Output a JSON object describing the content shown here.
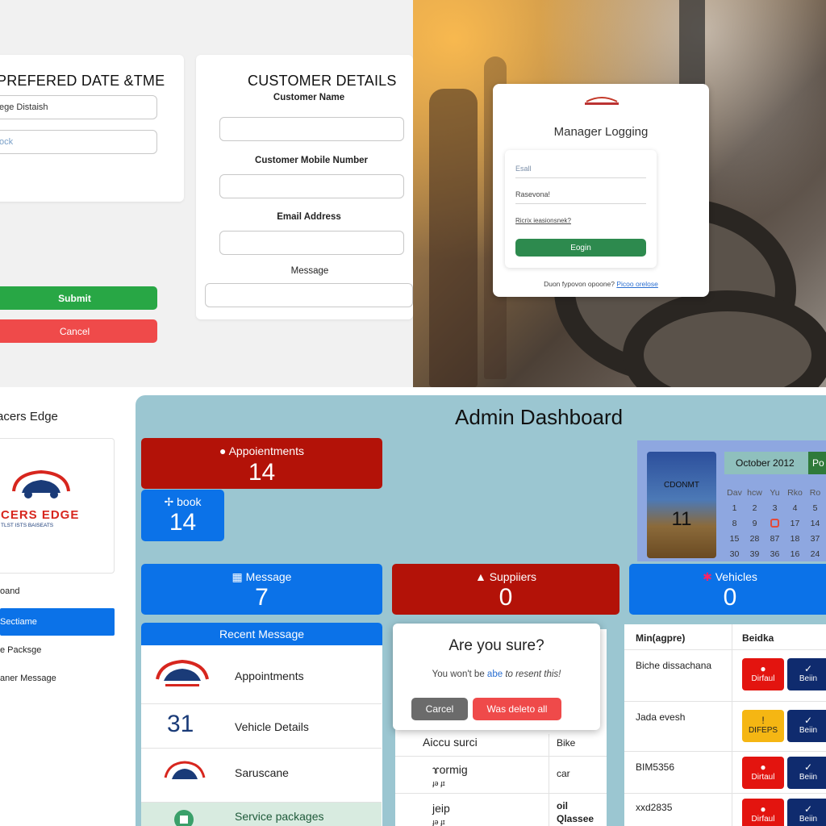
{
  "booking": {
    "date_title": "PREFERED DATE &TME",
    "date_value": "ege Distaish",
    "time_placeholder": "ock",
    "customer_title": "CUSTOMER DETAILS",
    "name_label": "Customer  Name",
    "mobile_label": "Customer Mobile Number",
    "email_label": "Email Address",
    "message_label": "Message",
    "submit_label": "Submit",
    "cancel_label": "Cancel"
  },
  "login": {
    "title": "Manager Logging",
    "email_placeholder": "Esall",
    "password_placeholder": "Rasevona!",
    "forgot": "Ricrix ieasionsnek?",
    "button": "Eogin",
    "signup_text": "Duon fypovon opoone?",
    "signup_link": "Picoo orelose"
  },
  "sidebar": {
    "brand": "acers Edge",
    "logo_name": "CERS EDGE",
    "logo_tag": "TLST ISTS BAISEATS",
    "items": [
      {
        "label": "oand"
      },
      {
        "label": "Sectiame"
      },
      {
        "label": "e Packsge"
      },
      {
        "label": "aner Message"
      }
    ]
  },
  "dashboard": {
    "title": "Admin Dashboard",
    "appointments": {
      "label": "Appoientments",
      "value": "14"
    },
    "book": {
      "label": "book",
      "value": "14"
    },
    "message": {
      "label": "Message",
      "value": "7"
    },
    "suppliers": {
      "label": "Suppiiers",
      "value": "0"
    },
    "vehicles": {
      "label": "Vehicles",
      "value": "0"
    },
    "calendar": {
      "month": "October 2012",
      "next": "Po",
      "image_text": "CDONMT",
      "image_num": "11",
      "headers": [
        "Dav",
        "hcw",
        "Yu",
        "Rko",
        "Ro"
      ],
      "rows": [
        [
          "1",
          "2",
          "3",
          "4",
          "5"
        ],
        [
          "8",
          "9",
          "",
          "17",
          "14"
        ],
        [
          "15",
          "28",
          "87",
          "18",
          "37"
        ],
        [
          "30",
          "39",
          "36",
          "16",
          "24"
        ]
      ]
    },
    "recent": {
      "title": "Recent Message",
      "items": [
        {
          "label": "Appointments"
        },
        {
          "label": "Vehicle Details",
          "num": "31"
        },
        {
          "label": "Saruscane"
        },
        {
          "label": "Service packages"
        }
      ]
    },
    "dialog": {
      "title": "Are you sure?",
      "text_pre": "You won't be",
      "text_link": "abe",
      "text_post": "to resent this!",
      "cancel": "Carcel",
      "confirm": "Was deleto all"
    },
    "list": {
      "rows": [
        {
          "a": "Aiccu surci",
          "b": "Bike"
        },
        {
          "a": "ɤormig",
          "a2": "ɟə ɟɪ",
          "b": "car"
        },
        {
          "a": "jeip",
          "a2": "ɟə ɟɪ",
          "b": "oil",
          "b2": "Qlassee"
        }
      ]
    },
    "table": {
      "headers": [
        "Min(agpre)",
        "Beidka"
      ],
      "rows": [
        {
          "name": "Biche dissachana",
          "btn1": "Dirfaul",
          "btn1_color": "#e3140f",
          "btn2": "Beiin"
        },
        {
          "name": "Jada evesh",
          "btn1": "DIFEPS",
          "btn1_color": "#f5b613",
          "btn2": "Beiin"
        },
        {
          "name": "BIM5356",
          "btn1": "Dirtaul",
          "btn1_color": "#e3140f",
          "btn2": "Beiin"
        },
        {
          "name": "xxd2835",
          "btn1": "Dirfaul",
          "btn1_color": "#e3140f",
          "btn2": "Beiin"
        }
      ]
    }
  }
}
